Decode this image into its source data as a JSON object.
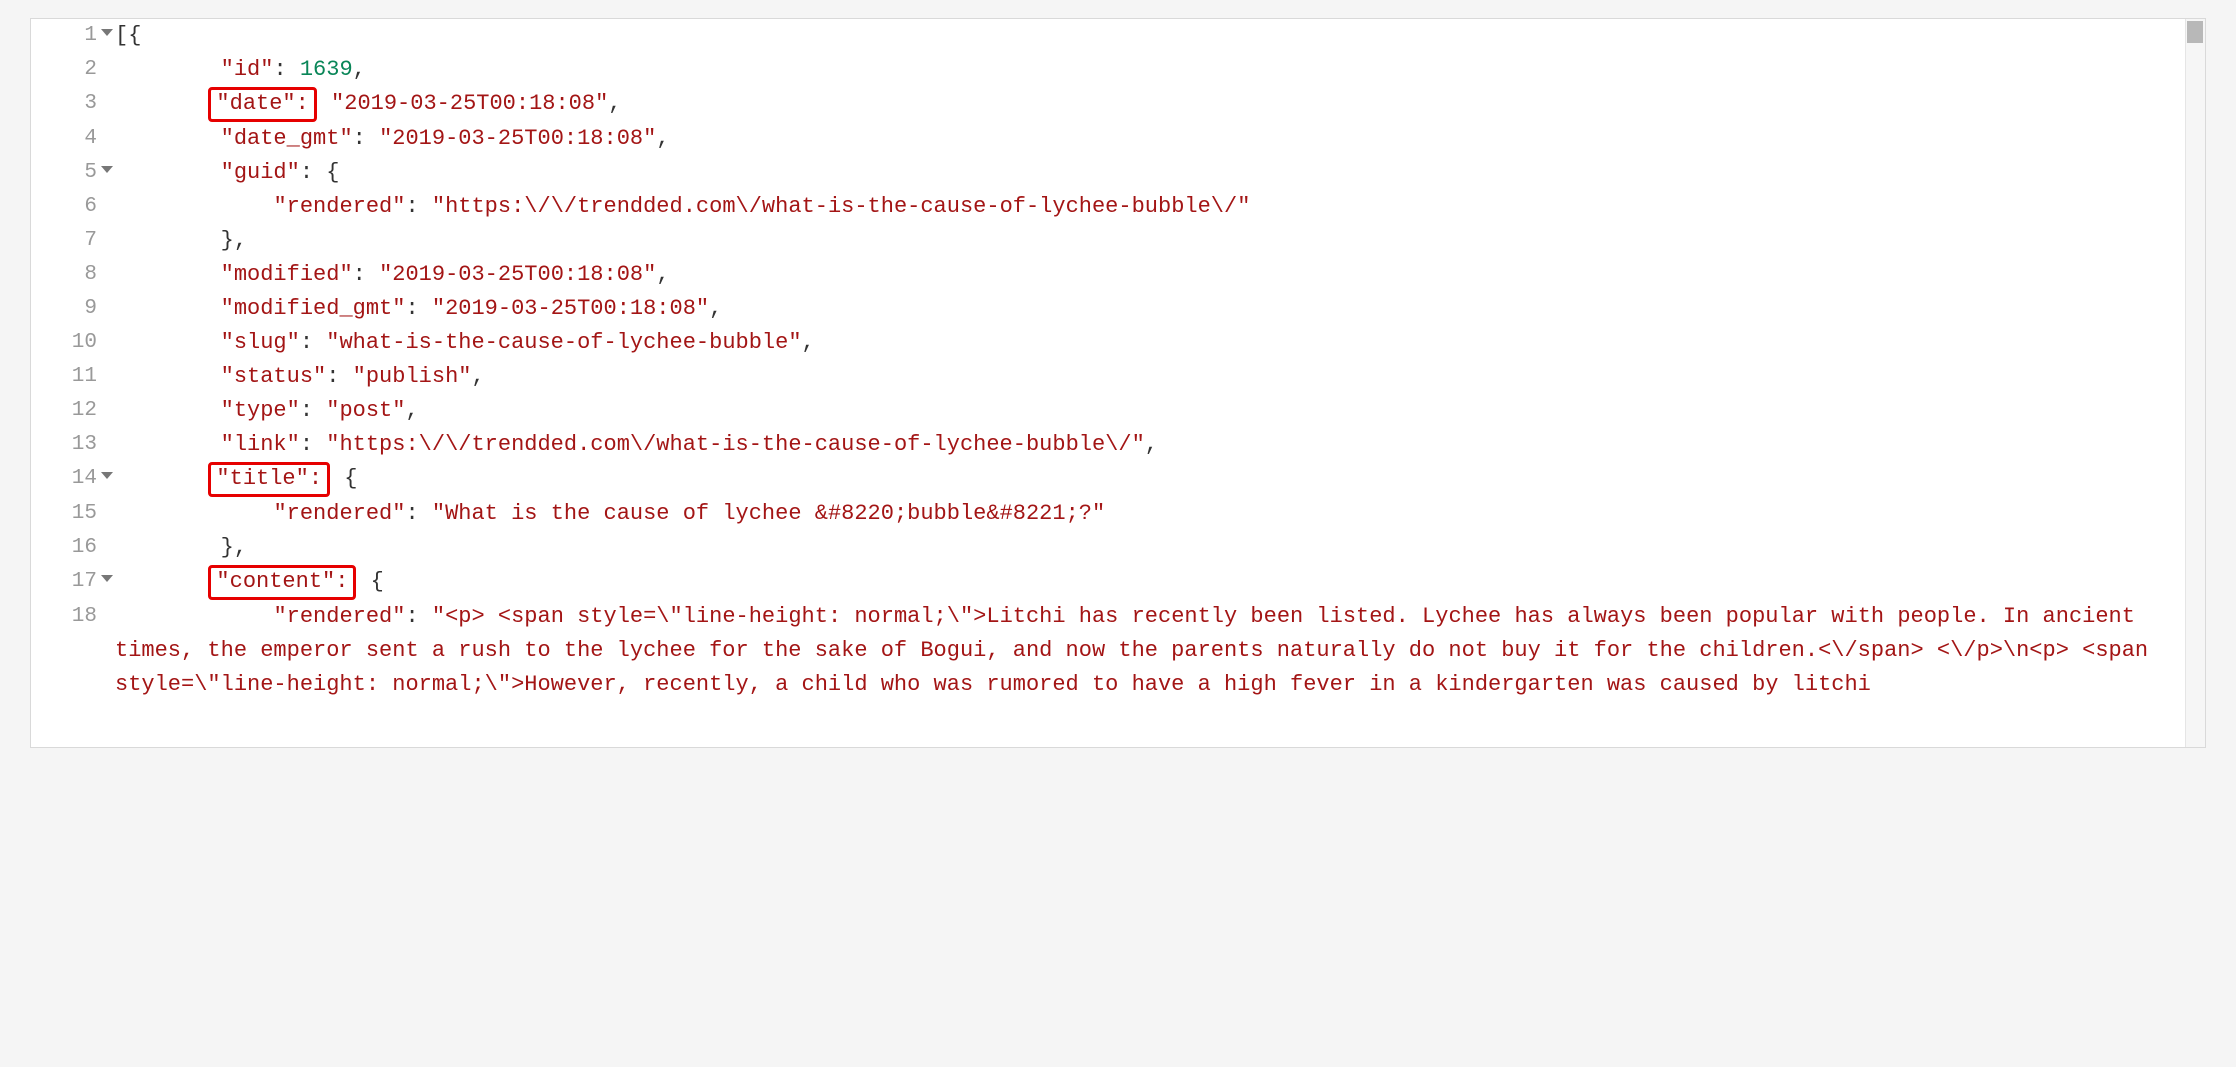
{
  "gutter": {
    "lines": [
      "1",
      "2",
      "3",
      "4",
      "5",
      "6",
      "7",
      "8",
      "9",
      "10",
      "11",
      "12",
      "13",
      "14",
      "15",
      "16",
      "17",
      "18"
    ],
    "foldable": [
      1,
      5,
      14,
      17
    ]
  },
  "highlighted_keys": {
    "line3": "\"date\":",
    "line14": "\"title\":",
    "line17": "\"content\":"
  },
  "code": {
    "l1": "[{",
    "l2_key": "\"id\"",
    "l2_sep": ": ",
    "l2_val": "1639",
    "l2_tail": ",",
    "l3_val": "\"2019-03-25T00:18:08\"",
    "l3_tail": ",",
    "l4_key": "\"date_gmt\"",
    "l4_sep": ": ",
    "l4_val": "\"2019-03-25T00:18:08\"",
    "l4_tail": ",",
    "l5_key": "\"guid\"",
    "l5_sep": ": ",
    "l5_brace": "{",
    "l6_key": "\"rendered\"",
    "l6_sep": ": ",
    "l6_val": "\"https:\\/\\/trendded.com\\/what-is-the-cause-of-lychee-bubble\\/\"",
    "l7": "},",
    "l8_key": "\"modified\"",
    "l8_sep": ": ",
    "l8_val": "\"2019-03-25T00:18:08\"",
    "l8_tail": ",",
    "l9_key": "\"modified_gmt\"",
    "l9_sep": ": ",
    "l9_val": "\"2019-03-25T00:18:08\"",
    "l9_tail": ",",
    "l10_key": "\"slug\"",
    "l10_sep": ": ",
    "l10_val": "\"what-is-the-cause-of-lychee-bubble\"",
    "l10_tail": ",",
    "l11_key": "\"status\"",
    "l11_sep": ": ",
    "l11_val": "\"publish\"",
    "l11_tail": ",",
    "l12_key": "\"type\"",
    "l12_sep": ": ",
    "l12_val": "\"post\"",
    "l12_tail": ",",
    "l13_key": "\"link\"",
    "l13_sep": ": ",
    "l13_val": "\"https:\\/\\/trendded.com\\/what-is-the-cause-of-lychee-bubble\\/\"",
    "l13_tail": ",",
    "l14_brace": "{",
    "l15_key": "\"rendered\"",
    "l15_sep": ": ",
    "l15_val": "\"What is the cause of lychee &#8220;bubble&#8221;?\"",
    "l16": "},",
    "l17_brace": "{",
    "l18_key": "\"rendered\"",
    "l18_sep": ": ",
    "l18_val": "\"<p> <span style=\\\"line-height: normal;\\\">Litchi has recently been listed. Lychee has always been popular with people. In ancient times, the emperor sent a rush to the lychee for the sake of Bogui, and now the parents naturally do not buy it for the children.<\\/span> <\\/p>\\n<p> <span style=\\\"line-height: normal;\\\">However, recently, a child who was rumored to have a high fever in a kindergarten was caused by litchi"
  }
}
